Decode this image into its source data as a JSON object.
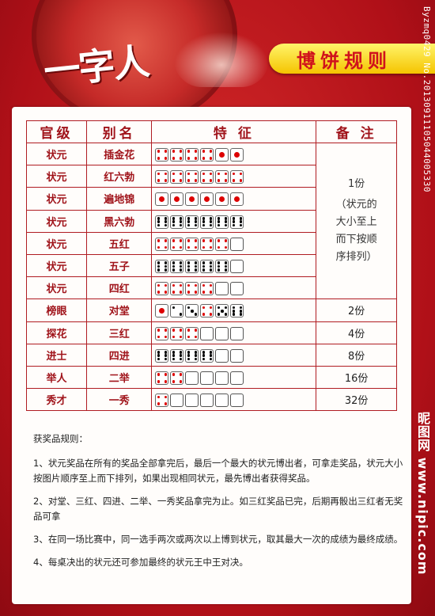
{
  "header": {
    "logo_text": "一字人",
    "title": "博饼规则",
    "side_watermark": "Byzmq0429 No.20130911105044005330",
    "side_watermark2": "昵图网 www.nipic.com"
  },
  "table": {
    "headers": [
      "官级",
      "别名",
      "特 征",
      "备 注"
    ],
    "rows": [
      {
        "rank": "状元",
        "alias": "插金花",
        "dice": [
          4,
          4,
          4,
          4,
          1,
          1
        ]
      },
      {
        "rank": "状元",
        "alias": "红六勃",
        "dice": [
          4,
          4,
          4,
          4,
          4,
          4
        ]
      },
      {
        "rank": "状元",
        "alias": "遍地锦",
        "dice": [
          1,
          1,
          1,
          1,
          1,
          1
        ]
      },
      {
        "rank": "状元",
        "alias": "黑六勃",
        "dice": [
          6,
          6,
          6,
          6,
          6,
          6
        ]
      },
      {
        "rank": "状元",
        "alias": "五红",
        "dice": [
          4,
          4,
          4,
          4,
          4,
          0
        ]
      },
      {
        "rank": "状元",
        "alias": "五子",
        "dice": [
          6,
          6,
          6,
          6,
          6,
          0
        ]
      },
      {
        "rank": "状元",
        "alias": "四红",
        "dice": [
          4,
          4,
          4,
          4,
          0,
          0
        ]
      },
      {
        "rank": "榜眼",
        "alias": "对堂",
        "dice": [
          1,
          2,
          3,
          4,
          5,
          6
        ],
        "note": "2份"
      },
      {
        "rank": "探花",
        "alias": "三红",
        "dice": [
          4,
          4,
          4,
          0,
          0,
          0
        ],
        "note": "4份"
      },
      {
        "rank": "进士",
        "alias": "四进",
        "dice": [
          6,
          6,
          6,
          6,
          0,
          0
        ],
        "note": "8份"
      },
      {
        "rank": "举人",
        "alias": "二举",
        "dice": [
          4,
          4,
          0,
          0,
          0,
          0
        ],
        "note": "16份"
      },
      {
        "rank": "秀才",
        "alias": "一秀",
        "dice": [
          4,
          0,
          0,
          0,
          0,
          0
        ],
        "note": "32份"
      }
    ],
    "zhuangyuan_note": "1份\n（状元的\n大小至上\n而下按顺\n序排列）"
  },
  "rules": {
    "heading": "获奖品规则：",
    "items": [
      "1、状元奖品在所有的奖品全部拿完后，最后一个最大的状元博出者，可拿走奖品，状元大小按图片顺序至上而下排列，如果出现相同状元，最先博出者获得奖品。",
      "2、对堂、三红、四进、二举、一秀奖品拿完为止。如三红奖品已完，后期再骰出三红者无奖品可拿",
      "3、在同一场比赛中，同一选手两次或两次以上博到状元，取其最大一次的成绩为最终成绩。",
      "4、每桌决出的状元还可参加最终的状元王中王对决。"
    ]
  }
}
